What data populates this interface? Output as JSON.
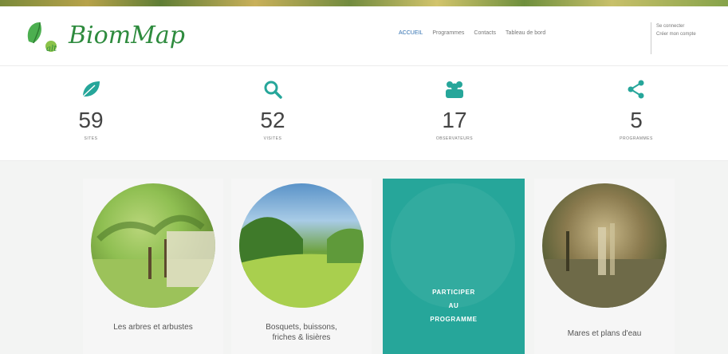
{
  "brand": {
    "name": "BiomMap",
    "color": "#2e8b3e",
    "accent": "#26a69a"
  },
  "nav": {
    "items": [
      "ACCUEIL",
      "Programmes",
      "Contacts",
      "Tableau de bord"
    ]
  },
  "login": {
    "line1": "Se connecter",
    "line2": "Créer mon compte"
  },
  "stats": [
    {
      "icon": "leaf-icon",
      "value": "59",
      "label": "SITES"
    },
    {
      "icon": "search-icon",
      "value": "52",
      "label": "VISITES"
    },
    {
      "icon": "users-icon",
      "value": "17",
      "label": "OBSERVATEURS"
    },
    {
      "icon": "share-icon",
      "value": "5",
      "label": "PROGRAMMES"
    }
  ],
  "cards": [
    {
      "caption": "Les arbres et arbustes"
    },
    {
      "caption_line1": "Bosquets, buissons,",
      "caption_line2": "friches & lisières"
    },
    {
      "cta_line1": "PARTICIPER",
      "cta_line2": "AU",
      "cta_line3": "PROGRAMME"
    },
    {
      "caption": "Mares et plans d'eau"
    }
  ]
}
